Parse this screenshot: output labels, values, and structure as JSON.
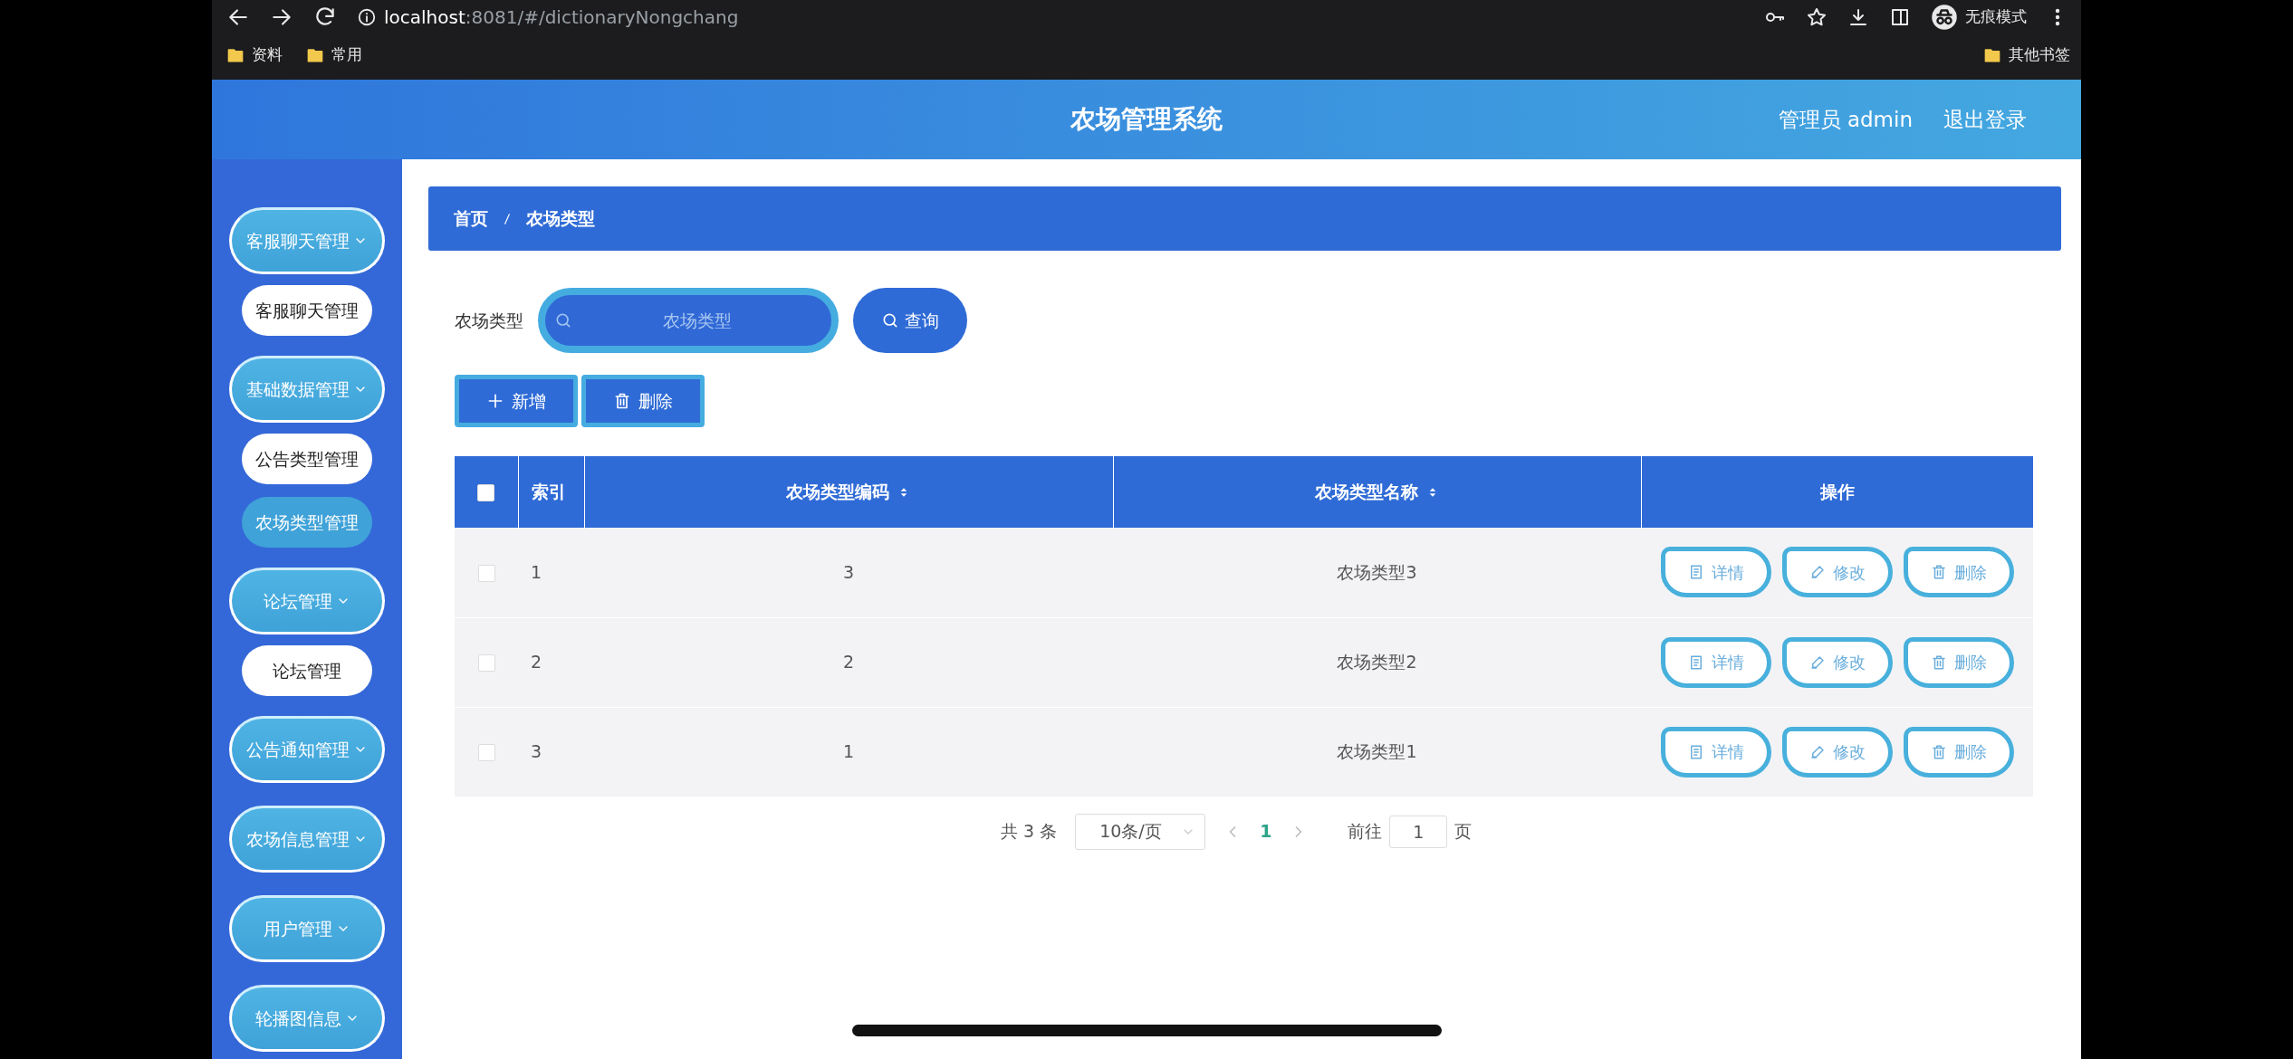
{
  "browser": {
    "url_host": "localhost",
    "url_path": ":8081/#/dictionaryNongchang",
    "profile_label": "无痕模式",
    "bookmarks": [
      "资料",
      "常用"
    ],
    "other_bookmarks": "其他书签"
  },
  "header": {
    "title": "农场管理系统",
    "user": "管理员 admin",
    "logout": "退出登录"
  },
  "sidebar": [
    {
      "kind": "group",
      "label": "客服聊天管理"
    },
    {
      "kind": "sub",
      "label": "客服聊天管理",
      "selected": false
    },
    {
      "kind": "group",
      "label": "基础数据管理"
    },
    {
      "kind": "sub",
      "label": "公告类型管理",
      "selected": false
    },
    {
      "kind": "sub",
      "label": "农场类型管理",
      "selected": true
    },
    {
      "kind": "group",
      "label": "论坛管理"
    },
    {
      "kind": "sub",
      "label": "论坛管理",
      "selected": false
    },
    {
      "kind": "group",
      "label": "公告通知管理"
    },
    {
      "kind": "group",
      "label": "农场信息管理"
    },
    {
      "kind": "group",
      "label": "用户管理"
    },
    {
      "kind": "group",
      "label": "轮播图信息"
    }
  ],
  "breadcrumb": [
    "首页",
    "农场类型"
  ],
  "search": {
    "label": "农场类型",
    "placeholder": "农场类型",
    "button": "查询"
  },
  "toolbar": [
    {
      "kind": "add",
      "label": "新增"
    },
    {
      "kind": "delete",
      "label": "删除"
    }
  ],
  "table": {
    "select_all": false,
    "columns": [
      {
        "label": "索引",
        "sortable": false
      },
      {
        "label": "农场类型编码",
        "sortable": true
      },
      {
        "label": "农场类型名称",
        "sortable": true
      },
      {
        "label": "操作",
        "sortable": false
      }
    ],
    "rows": [
      {
        "checked": false,
        "cells": [
          "1",
          "3",
          "农场类型3"
        ],
        "actions": [
          {
            "kind": "detail",
            "label": "详情"
          },
          {
            "kind": "edit",
            "label": "修改"
          },
          {
            "kind": "delete",
            "label": "删除"
          }
        ]
      },
      {
        "checked": false,
        "cells": [
          "2",
          "2",
          "农场类型2"
        ],
        "actions": [
          {
            "kind": "detail",
            "label": "详情"
          },
          {
            "kind": "edit",
            "label": "修改"
          },
          {
            "kind": "delete",
            "label": "删除"
          }
        ]
      },
      {
        "checked": false,
        "cells": [
          "3",
          "1",
          "农场类型1"
        ],
        "actions": [
          {
            "kind": "detail",
            "label": "详情"
          },
          {
            "kind": "edit",
            "label": "修改"
          },
          {
            "kind": "delete",
            "label": "删除"
          }
        ]
      }
    ]
  },
  "pagination": {
    "total": "共 3 条",
    "page_size": "10条/页",
    "pages": [
      {
        "label": "1",
        "selected": true
      }
    ],
    "goto_label": "前往",
    "goto_value": "1",
    "goto_suffix": "页"
  }
}
